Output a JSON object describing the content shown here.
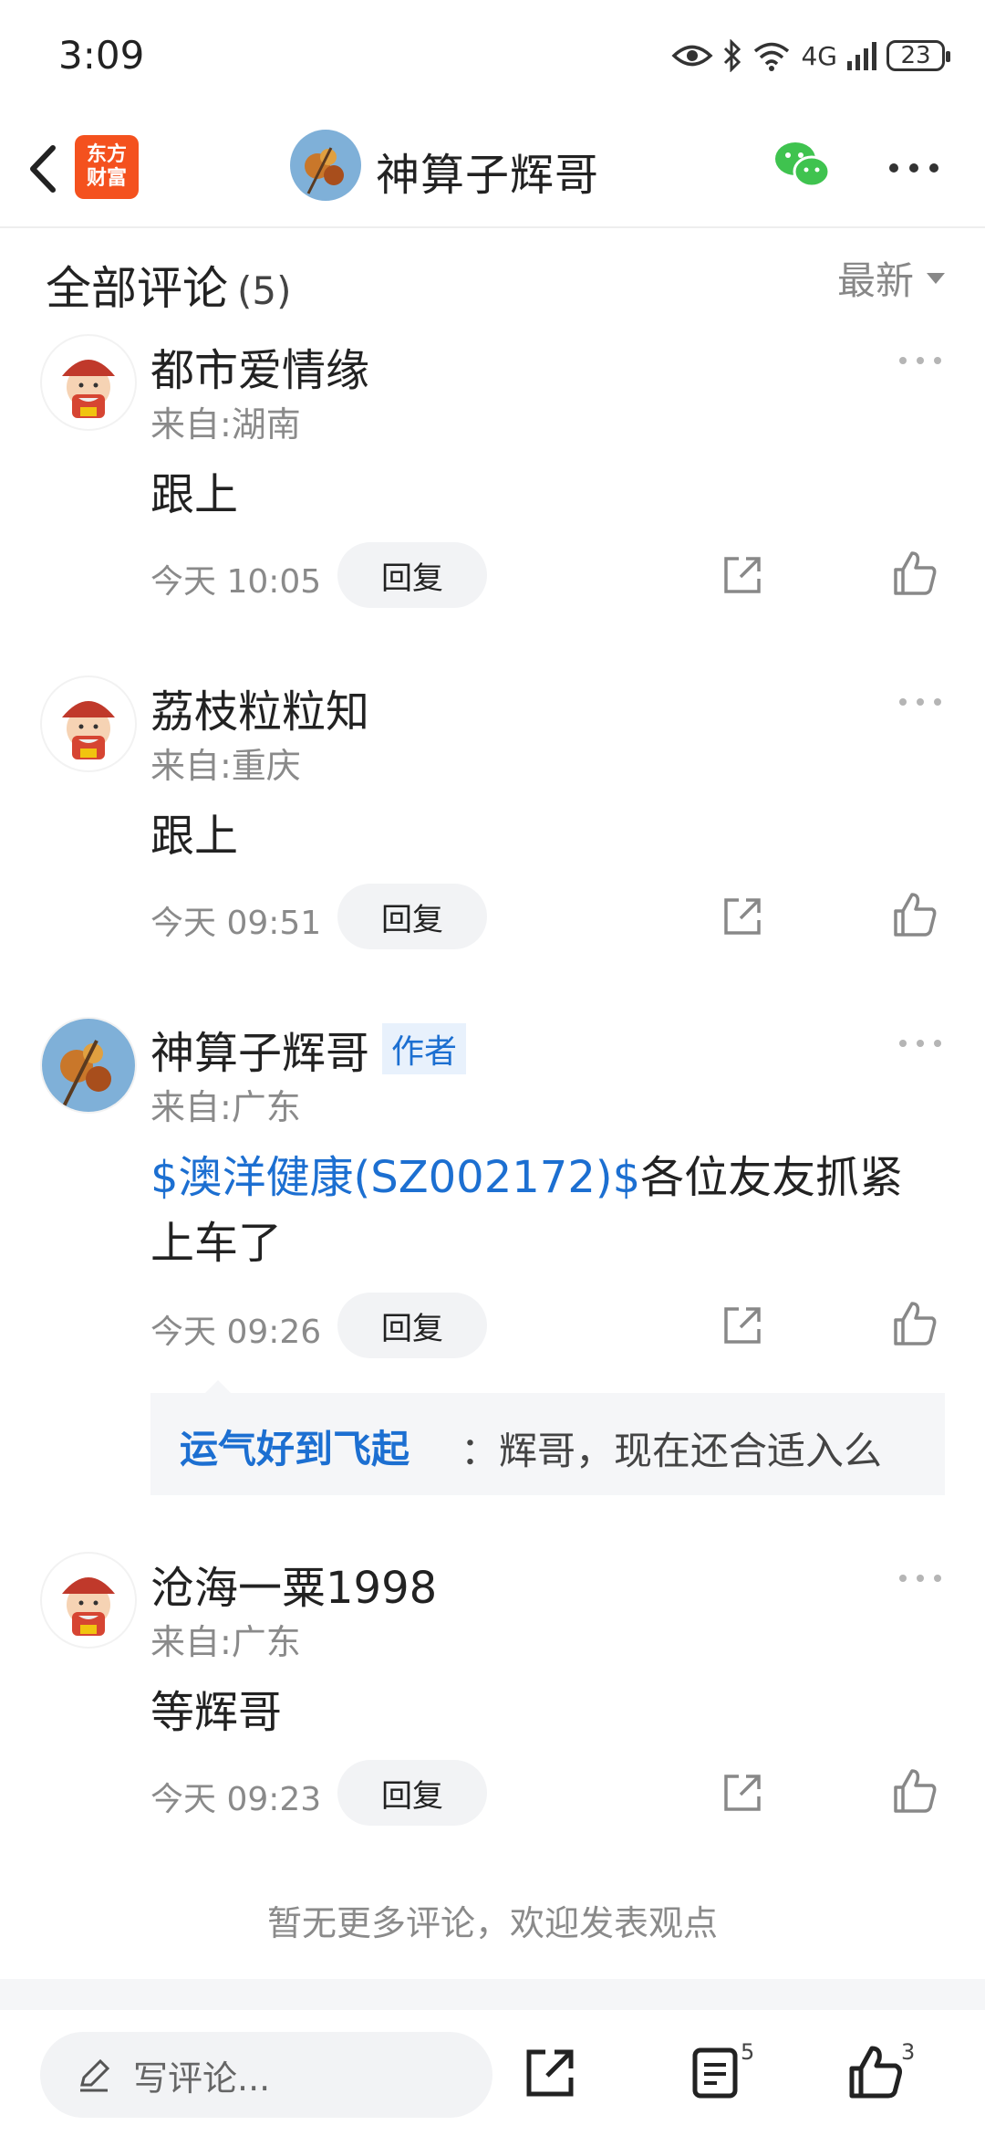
{
  "status_bar": {
    "time": "3:09",
    "battery": "23",
    "network": "4G"
  },
  "nav": {
    "app_logo_line1": "东方",
    "app_logo_line2": "财富",
    "title": "神算子辉哥"
  },
  "comments_header": {
    "title": "全部评论",
    "count": "(5)",
    "sort_label": "最新"
  },
  "comments": [
    {
      "name": "都市爱情缘",
      "location": "来自:湖南",
      "text": "跟上",
      "time": "今天 10:05",
      "reply_label": "回复"
    },
    {
      "name": "荔枝粒粒知",
      "location": "来自:重庆",
      "text": "跟上",
      "time": "今天 09:51",
      "reply_label": "回复"
    },
    {
      "name": "神算子辉哥",
      "badge": "作者",
      "location": "来自:广东",
      "stock_link": "$澳洋健康(SZ002172)$",
      "text": "各位友友抓紧上车了",
      "time": "今天 09:26",
      "reply_label": "回复",
      "sub_reply": {
        "name": "运气好到飞起",
        "text": "：辉哥，现在还合适入么"
      }
    },
    {
      "name": "沧海一粟1998",
      "location": "来自:广东",
      "text": "等辉哥",
      "time": "今天 09:23",
      "reply_label": "回复"
    }
  ],
  "footer_note": "暂无更多评论，欢迎发表观点",
  "bottom_bar": {
    "input_placeholder": "写评论...",
    "comment_count": "5",
    "like_count": "3"
  },
  "colors": {
    "link": "#1c6fd1",
    "logo_orange": "#f4511e",
    "wechat_green": "#3fc34f"
  }
}
